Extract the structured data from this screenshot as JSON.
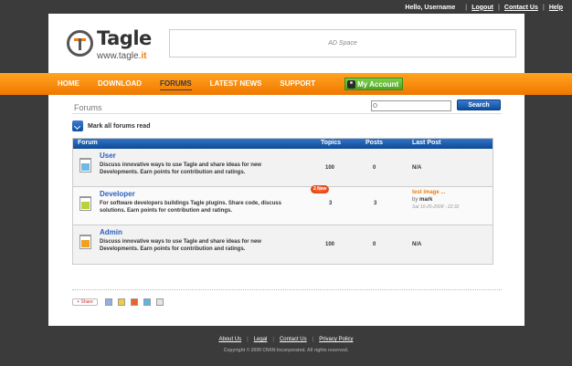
{
  "top_bar": {
    "greeting": "Hello, Username",
    "links": [
      "Logout",
      "Contact Us",
      "Help"
    ]
  },
  "header": {
    "logo_name": "Tagle",
    "logo_url_prefix": "www.tagle.",
    "logo_url_suffix": "it",
    "ad_text": "AD Space"
  },
  "nav": {
    "items": [
      "HOME",
      "DOWNLOAD",
      "FORUMS",
      "LATEST NEWS",
      "SUPPORT"
    ],
    "active": "FORUMS",
    "my_account": "My Account"
  },
  "page": {
    "title": "Forums",
    "search_placeholder": "",
    "search_button": "Search",
    "mark_read": "Mark all forums read"
  },
  "table": {
    "headers": [
      "Forum",
      "Topics",
      "Posts",
      "Last Post"
    ],
    "rows": [
      {
        "name": "User",
        "description": "Discuss innovative ways to use Tagle and share ideas for new Developments. Earn points for contribution and ratings.",
        "topics": "100",
        "posts": "0",
        "last_post": "N/A",
        "icon_color": "#6fb9e6"
      },
      {
        "name": "Developer",
        "description": "For software developers buildings Tagle plugins. Share code, discuss solutions. Earn points for contribution and ratings.",
        "topics": "3",
        "posts": "3",
        "badge": "2 New",
        "last_post_title": "test image ...",
        "last_post_by_label": "by",
        "last_post_by": "mark",
        "last_post_date": "Sat 10-25-2008 - 22:32",
        "icon_color": "#b6d43a"
      },
      {
        "name": "Admin",
        "description": "Discuss innovative ways to use Tagle and share ideas for new Developments. Earn points for contribution and ratings.",
        "topics": "100",
        "posts": "0",
        "last_post": "N/A",
        "icon_color": "#f2a020"
      }
    ]
  },
  "share": {
    "button": "+ Share",
    "icons": [
      {
        "name": "share-icon-1",
        "color": "#8fb0e0"
      },
      {
        "name": "share-icon-2",
        "color": "#f2cc3a"
      },
      {
        "name": "share-icon-3",
        "color": "#e8642a"
      },
      {
        "name": "share-icon-4",
        "color": "#5ab8e8"
      },
      {
        "name": "share-icon-5",
        "color": "#e4e4e4"
      }
    ]
  },
  "footer": {
    "links": [
      "About Us",
      "Legal",
      "Contact Us",
      "Privacy Policy"
    ],
    "copyright": "Copyright © 2009 CNXN Incorporated. All rights reserved."
  }
}
